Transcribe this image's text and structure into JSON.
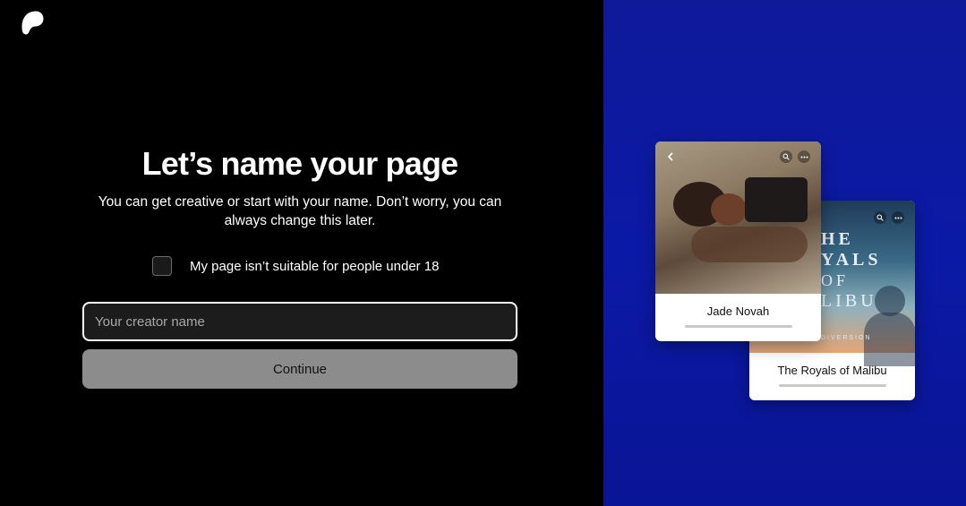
{
  "brand": {
    "logo_icon": "patreon-logo-icon"
  },
  "main": {
    "title": "Let’s name your page",
    "subtitle": "You can get creative or start with your name. Don’t worry, you can always change this later.",
    "adult_checkbox": {
      "label": "My page isn’t suitable for people under 18",
      "checked": false
    },
    "creator_name": {
      "placeholder": "Your creator name",
      "value": ""
    },
    "continue_label": "Continue"
  },
  "preview": {
    "background_color": "#0b1aa6",
    "cards": [
      {
        "name": "Jade Novah",
        "icons": [
          "back-arrow-icon",
          "search-icon",
          "more-icon"
        ]
      },
      {
        "name": "The Royals of Malibu",
        "poster_title_lines": [
          "HE",
          "YALS",
          "OF",
          "LIBU"
        ],
        "poster_brand": "DIVERSION",
        "icons": [
          "search-icon",
          "more-icon"
        ]
      }
    ]
  }
}
